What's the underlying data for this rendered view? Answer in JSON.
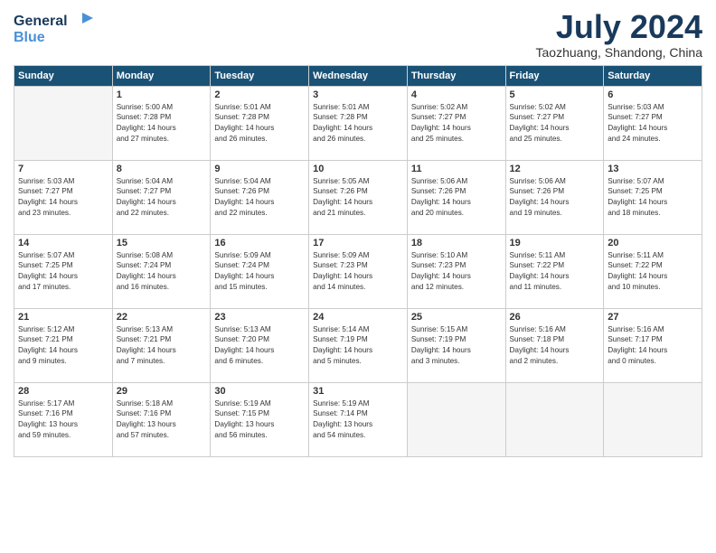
{
  "logo": {
    "line1": "General",
    "line2": "Blue"
  },
  "title": "July 2024",
  "subtitle": "Taozhuang, Shandong, China",
  "days_of_week": [
    "Sunday",
    "Monday",
    "Tuesday",
    "Wednesday",
    "Thursday",
    "Friday",
    "Saturday"
  ],
  "weeks": [
    [
      {
        "day": "",
        "text": ""
      },
      {
        "day": "1",
        "text": "Sunrise: 5:00 AM\nSunset: 7:28 PM\nDaylight: 14 hours\nand 27 minutes."
      },
      {
        "day": "2",
        "text": "Sunrise: 5:01 AM\nSunset: 7:28 PM\nDaylight: 14 hours\nand 26 minutes."
      },
      {
        "day": "3",
        "text": "Sunrise: 5:01 AM\nSunset: 7:28 PM\nDaylight: 14 hours\nand 26 minutes."
      },
      {
        "day": "4",
        "text": "Sunrise: 5:02 AM\nSunset: 7:27 PM\nDaylight: 14 hours\nand 25 minutes."
      },
      {
        "day": "5",
        "text": "Sunrise: 5:02 AM\nSunset: 7:27 PM\nDaylight: 14 hours\nand 25 minutes."
      },
      {
        "day": "6",
        "text": "Sunrise: 5:03 AM\nSunset: 7:27 PM\nDaylight: 14 hours\nand 24 minutes."
      }
    ],
    [
      {
        "day": "7",
        "text": "Sunrise: 5:03 AM\nSunset: 7:27 PM\nDaylight: 14 hours\nand 23 minutes."
      },
      {
        "day": "8",
        "text": "Sunrise: 5:04 AM\nSunset: 7:27 PM\nDaylight: 14 hours\nand 22 minutes."
      },
      {
        "day": "9",
        "text": "Sunrise: 5:04 AM\nSunset: 7:26 PM\nDaylight: 14 hours\nand 22 minutes."
      },
      {
        "day": "10",
        "text": "Sunrise: 5:05 AM\nSunset: 7:26 PM\nDaylight: 14 hours\nand 21 minutes."
      },
      {
        "day": "11",
        "text": "Sunrise: 5:06 AM\nSunset: 7:26 PM\nDaylight: 14 hours\nand 20 minutes."
      },
      {
        "day": "12",
        "text": "Sunrise: 5:06 AM\nSunset: 7:26 PM\nDaylight: 14 hours\nand 19 minutes."
      },
      {
        "day": "13",
        "text": "Sunrise: 5:07 AM\nSunset: 7:25 PM\nDaylight: 14 hours\nand 18 minutes."
      }
    ],
    [
      {
        "day": "14",
        "text": "Sunrise: 5:07 AM\nSunset: 7:25 PM\nDaylight: 14 hours\nand 17 minutes."
      },
      {
        "day": "15",
        "text": "Sunrise: 5:08 AM\nSunset: 7:24 PM\nDaylight: 14 hours\nand 16 minutes."
      },
      {
        "day": "16",
        "text": "Sunrise: 5:09 AM\nSunset: 7:24 PM\nDaylight: 14 hours\nand 15 minutes."
      },
      {
        "day": "17",
        "text": "Sunrise: 5:09 AM\nSunset: 7:23 PM\nDaylight: 14 hours\nand 14 minutes."
      },
      {
        "day": "18",
        "text": "Sunrise: 5:10 AM\nSunset: 7:23 PM\nDaylight: 14 hours\nand 12 minutes."
      },
      {
        "day": "19",
        "text": "Sunrise: 5:11 AM\nSunset: 7:22 PM\nDaylight: 14 hours\nand 11 minutes."
      },
      {
        "day": "20",
        "text": "Sunrise: 5:11 AM\nSunset: 7:22 PM\nDaylight: 14 hours\nand 10 minutes."
      }
    ],
    [
      {
        "day": "21",
        "text": "Sunrise: 5:12 AM\nSunset: 7:21 PM\nDaylight: 14 hours\nand 9 minutes."
      },
      {
        "day": "22",
        "text": "Sunrise: 5:13 AM\nSunset: 7:21 PM\nDaylight: 14 hours\nand 7 minutes."
      },
      {
        "day": "23",
        "text": "Sunrise: 5:13 AM\nSunset: 7:20 PM\nDaylight: 14 hours\nand 6 minutes."
      },
      {
        "day": "24",
        "text": "Sunrise: 5:14 AM\nSunset: 7:19 PM\nDaylight: 14 hours\nand 5 minutes."
      },
      {
        "day": "25",
        "text": "Sunrise: 5:15 AM\nSunset: 7:19 PM\nDaylight: 14 hours\nand 3 minutes."
      },
      {
        "day": "26",
        "text": "Sunrise: 5:16 AM\nSunset: 7:18 PM\nDaylight: 14 hours\nand 2 minutes."
      },
      {
        "day": "27",
        "text": "Sunrise: 5:16 AM\nSunset: 7:17 PM\nDaylight: 14 hours\nand 0 minutes."
      }
    ],
    [
      {
        "day": "28",
        "text": "Sunrise: 5:17 AM\nSunset: 7:16 PM\nDaylight: 13 hours\nand 59 minutes."
      },
      {
        "day": "29",
        "text": "Sunrise: 5:18 AM\nSunset: 7:16 PM\nDaylight: 13 hours\nand 57 minutes."
      },
      {
        "day": "30",
        "text": "Sunrise: 5:19 AM\nSunset: 7:15 PM\nDaylight: 13 hours\nand 56 minutes."
      },
      {
        "day": "31",
        "text": "Sunrise: 5:19 AM\nSunset: 7:14 PM\nDaylight: 13 hours\nand 54 minutes."
      },
      {
        "day": "",
        "text": ""
      },
      {
        "day": "",
        "text": ""
      },
      {
        "day": "",
        "text": ""
      }
    ]
  ]
}
